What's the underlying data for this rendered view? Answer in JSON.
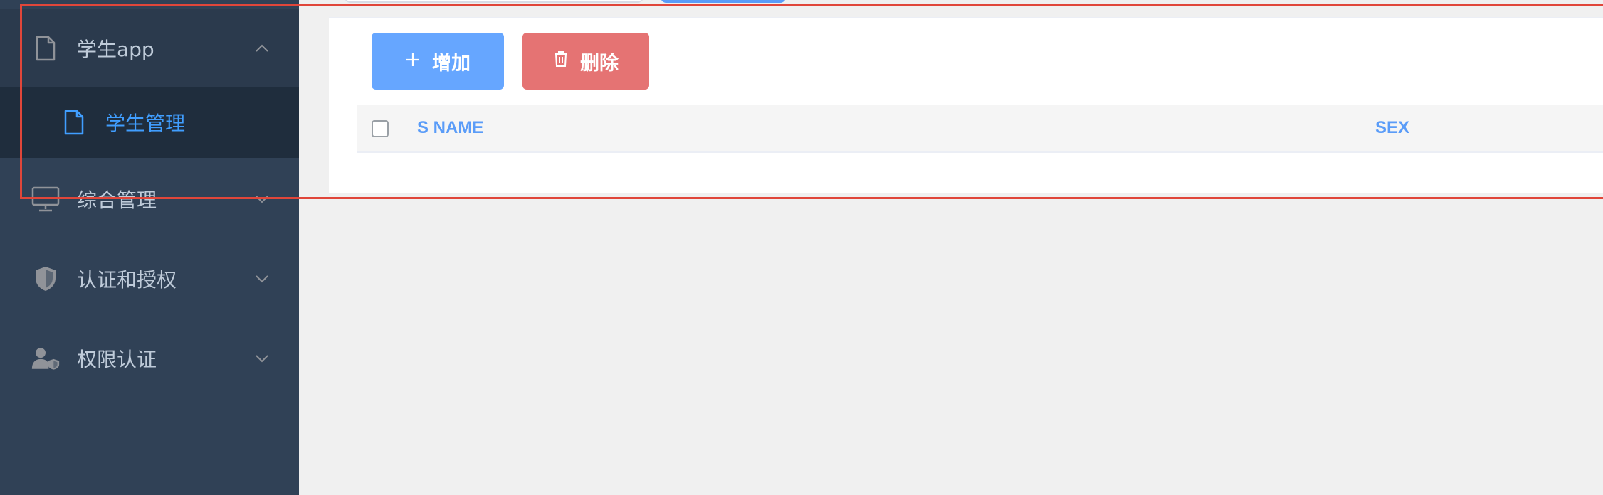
{
  "sidebar": {
    "items": [
      {
        "label": "学生app",
        "icon": "document-icon",
        "expanded": true
      },
      {
        "label": "综合管理",
        "icon": "monitor-icon",
        "expanded": false
      },
      {
        "label": "认证和授权",
        "icon": "shield-icon",
        "expanded": false
      },
      {
        "label": "权限认证",
        "icon": "user-shield-icon",
        "expanded": false
      }
    ],
    "submenu": {
      "label": "学生管理",
      "icon": "document-icon",
      "active": true
    }
  },
  "toolbar": {
    "add_label": "增加",
    "delete_label": "删除"
  },
  "table": {
    "columns": [
      "S NAME",
      "SEX"
    ]
  },
  "colors": {
    "sidebar_bg": "#304156",
    "submenu_bg": "#1f2d3d",
    "accent": "#409eff",
    "add_button": "#66a6ff",
    "delete_button": "#e57373",
    "highlight": "#e0463a"
  }
}
